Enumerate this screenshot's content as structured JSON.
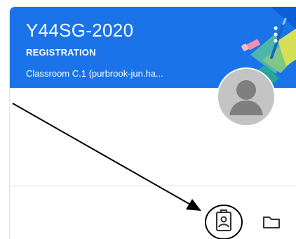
{
  "class_card": {
    "title": "Y44SG-2020",
    "section": "REGISTRATION",
    "room": "Classroom C.1 (purbrook-jun.ha...",
    "header_color": "#1a73e8"
  },
  "icons": {
    "more": "more-vert-icon",
    "avatar": "person-avatar-icon",
    "work": "assignment-ind-icon",
    "folder": "folder-icon"
  },
  "annotation": {
    "arrow_color": "#000000",
    "highlight_shape": "ellipse"
  }
}
